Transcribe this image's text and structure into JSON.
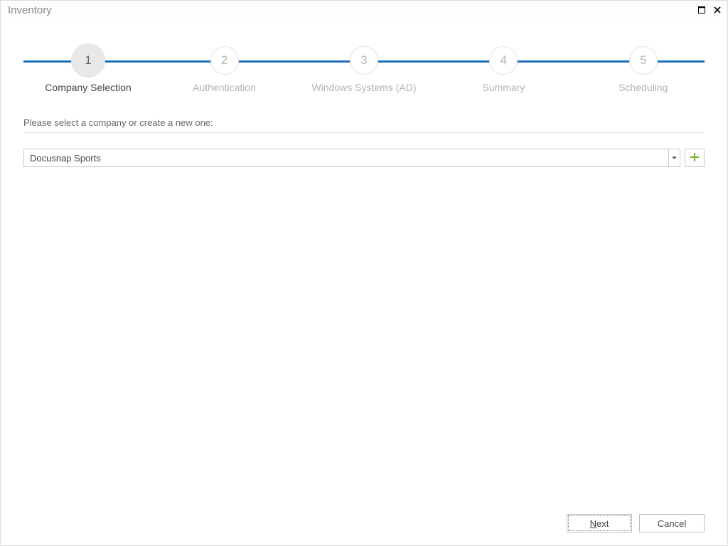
{
  "window": {
    "title": "Inventory"
  },
  "steps": [
    {
      "num": "1",
      "label": "Company Selection",
      "active": true
    },
    {
      "num": "2",
      "label": "Authentication",
      "active": false
    },
    {
      "num": "3",
      "label": "Windows Systems (AD)",
      "active": false
    },
    {
      "num": "4",
      "label": "Summary",
      "active": false
    },
    {
      "num": "5",
      "label": "Scheduling",
      "active": false
    }
  ],
  "prompt": "Please select a company or create a new one:",
  "company": {
    "selected": "Docusnap Sports"
  },
  "buttons": {
    "next_prefix": "N",
    "next_rest": "ext",
    "cancel": "Cancel"
  },
  "colors": {
    "accent": "#1e6fb8",
    "add_icon": "#76b82a"
  }
}
